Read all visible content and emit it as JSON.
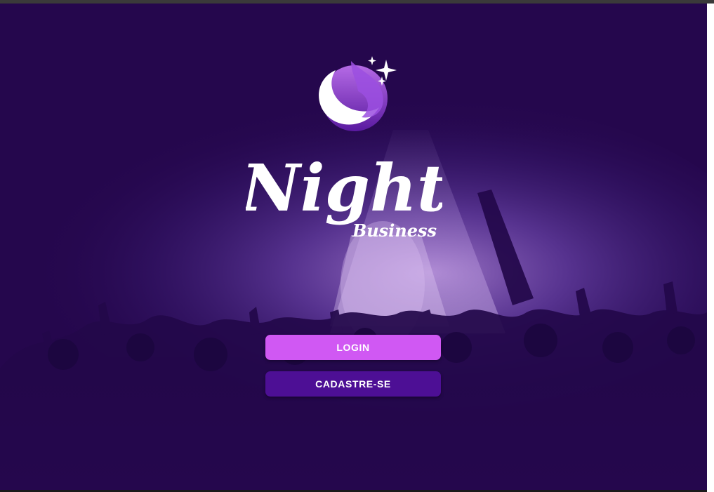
{
  "app": {
    "brand_script": "Night",
    "brand_sub": "Business"
  },
  "actions": {
    "login_label": "LOGIN",
    "signup_label": "CADASTRE-SE"
  },
  "colors": {
    "background": "#25074d",
    "login_button": "#d058f3",
    "signup_button": "#4d0f95",
    "logo_moon": "#ffffff",
    "logo_flame": "#8e3fd6"
  },
  "icons": {
    "logo": "moon-flame-icon",
    "sparkles": "sparkle-icon"
  }
}
